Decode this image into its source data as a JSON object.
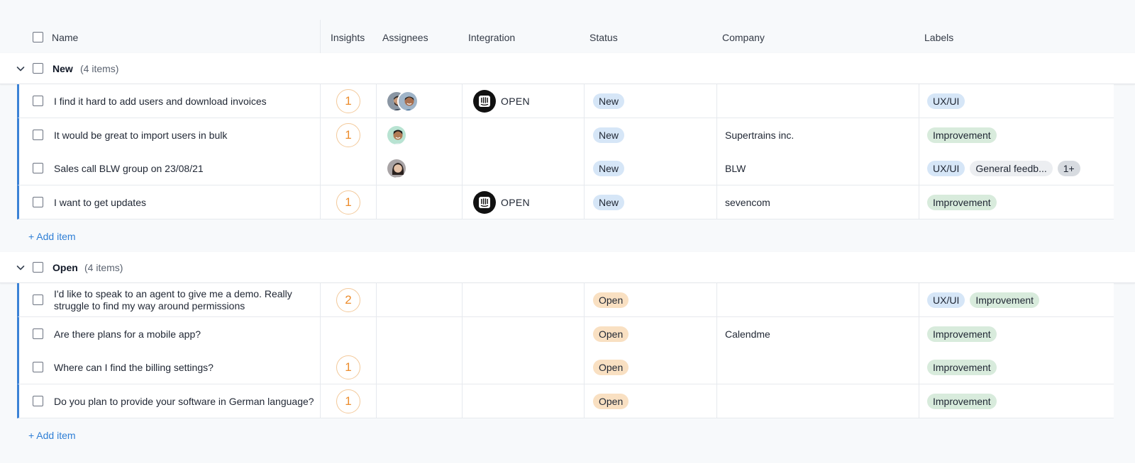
{
  "header": {
    "name": "Name",
    "insights": "Insights",
    "assignees": "Assignees",
    "integration": "Integration",
    "status": "Status",
    "company": "Company",
    "labels": "Labels"
  },
  "colors": {
    "accent": "#3b82d6",
    "status_new": "#d6e6f7",
    "status_open": "#f9e0c2",
    "label_uxui": "#d6e6f7",
    "label_improvement": "#d8ebdc",
    "label_general": "#eceef1",
    "label_more": "#d7dbe0",
    "insight": "#ec8c2c"
  },
  "groups": [
    {
      "title": "New",
      "count": "(4 items)",
      "add_label": "+ Add item",
      "rows": [
        {
          "name": "I find it hard to add users and download invoices",
          "insights": "1",
          "assignees": [
            "man-beard",
            "man-smile"
          ],
          "integration": "OPEN",
          "status": "New",
          "company": "",
          "labels": [
            "UX/UI"
          ]
        },
        {
          "name": "It would be great to import users in bulk",
          "insights": "1",
          "assignees": [
            "man-green"
          ],
          "integration": "",
          "status": "New",
          "company": "Supertrains inc.",
          "labels": [
            "Improvement"
          ]
        },
        {
          "name": "Sales call BLW group on 23/08/21",
          "insights": "",
          "assignees": [
            "woman"
          ],
          "integration": "",
          "status": "New",
          "company": "BLW",
          "labels": [
            "UX/UI",
            "General feedb...",
            "1+"
          ]
        },
        {
          "name": "I want to get updates",
          "insights": "1",
          "assignees": [],
          "integration": "OPEN",
          "status": "New",
          "company": "sevencom",
          "labels": [
            "Improvement"
          ]
        }
      ]
    },
    {
      "title": "Open",
      "count": "(4 items)",
      "add_label": "+ Add item",
      "rows": [
        {
          "name": "I'd like to speak to an agent to give me a demo. Really struggle to find my way around permissions",
          "insights": "2",
          "assignees": [],
          "integration": "",
          "status": "Open",
          "company": "",
          "labels": [
            "UX/UI",
            "Improvement"
          ]
        },
        {
          "name": "Are there plans for a mobile app?",
          "insights": "",
          "assignees": [],
          "integration": "",
          "status": "Open",
          "company": "Calendme",
          "labels": [
            "Improvement"
          ]
        },
        {
          "name": "Where can I find the billing settings?",
          "insights": "1",
          "assignees": [],
          "integration": "",
          "status": "Open",
          "company": "",
          "labels": [
            "Improvement"
          ]
        },
        {
          "name": "Do you plan to provide your software in German language?",
          "insights": "1",
          "assignees": [],
          "integration": "",
          "status": "Open",
          "company": "",
          "labels": [
            "Improvement"
          ]
        }
      ]
    }
  ]
}
